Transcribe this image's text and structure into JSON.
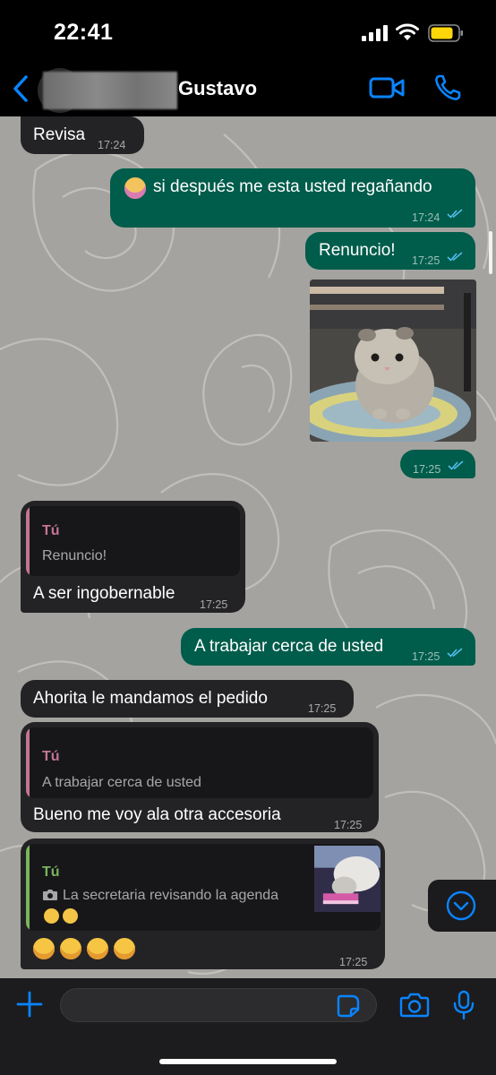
{
  "status_bar": {
    "time": "22:41"
  },
  "header": {
    "contact_name": "Gustavo"
  },
  "colors": {
    "accent": "#0a84ff",
    "outgoing_bubble": "#005c4b",
    "incoming_bubble": "#232326",
    "read_ticks": "#53bdeb",
    "quote_bar_pink": "#c37593",
    "quote_bar_green": "#7bb55c"
  },
  "messages": [
    {
      "direction": "in",
      "text": "Revisa",
      "time": "17:24"
    },
    {
      "direction": "out",
      "text": "si después me esta usted regañando",
      "time": "17:24",
      "emoji": "woman-tipping-hand",
      "status": "read"
    },
    {
      "direction": "out",
      "text": "Renuncio!",
      "time": "17:25",
      "status": "read"
    },
    {
      "direction": "out",
      "type": "photo",
      "image": "kitten-photo",
      "time": "17:25",
      "status": "read"
    },
    {
      "direction": "in",
      "quote_author": "Tú",
      "quote_text": "Renuncio!",
      "text": "A ser ingobernable",
      "time": "17:25"
    },
    {
      "direction": "out",
      "text": "A trabajar cerca de usted",
      "time": "17:25",
      "status": "read"
    },
    {
      "direction": "in",
      "text": "Ahorita le mandamos el pedido",
      "time": "17:25"
    },
    {
      "direction": "in",
      "quote_author": "Tú",
      "quote_text": "A trabajar cerca de usted",
      "text": "Bueno me voy ala otra accesoria",
      "time": "17:25"
    },
    {
      "direction": "in",
      "quote_author": "Tú",
      "quote_text": "La secretaria revisando la agenda",
      "quote_icon": "camera-icon",
      "quote_emojis": [
        "face-with-hand-over-mouth",
        "smiling-face-with-hearts"
      ],
      "quote_thumb": "cat-thumbnail",
      "emojis": [
        "face-with-tears-of-joy",
        "face-with-tears-of-joy",
        "face-with-tears-of-joy",
        "face-with-tears-of-joy"
      ],
      "time": "17:25"
    }
  ],
  "input": {
    "placeholder": "",
    "value": ""
  }
}
